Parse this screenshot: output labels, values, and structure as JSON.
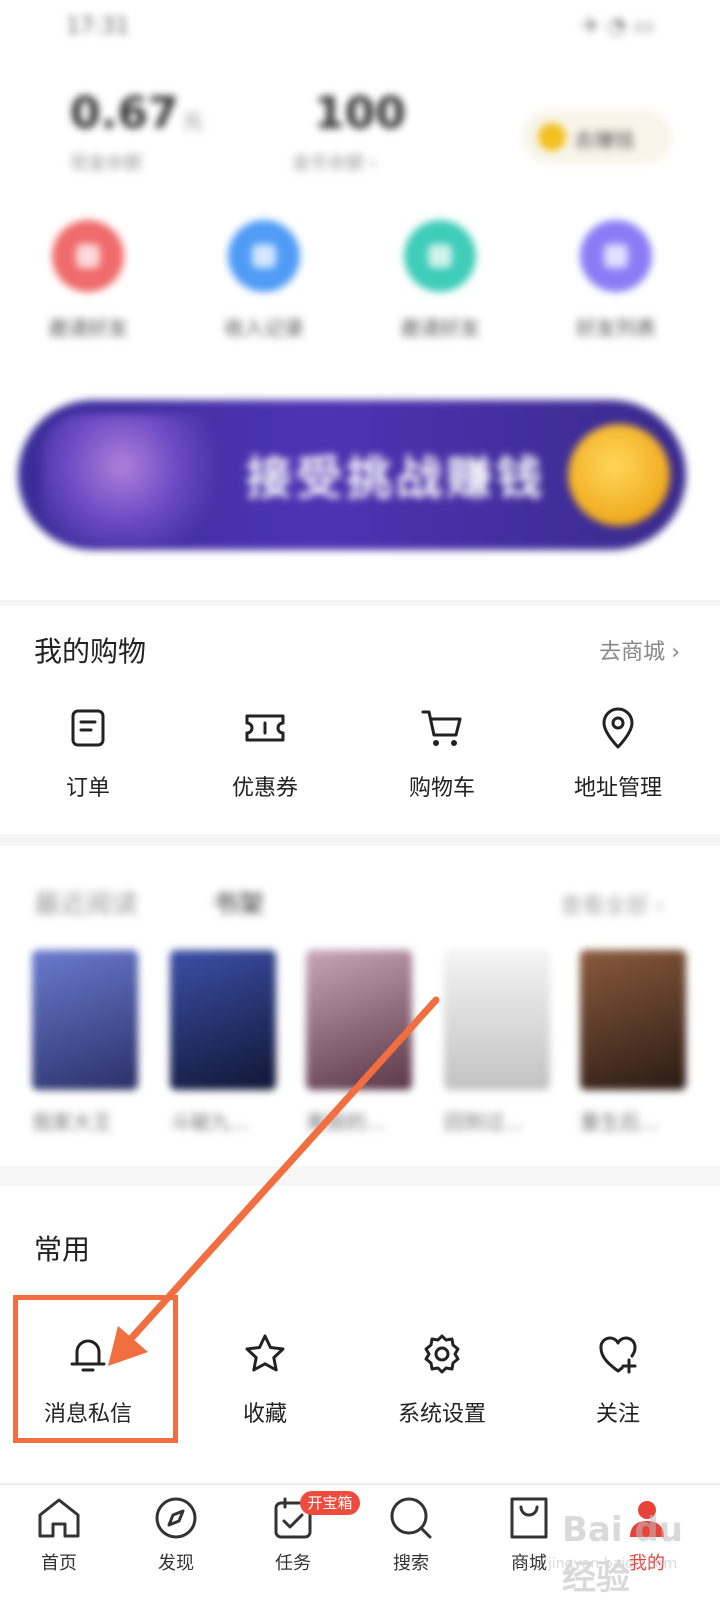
{
  "status_bar": {
    "time": "17:31",
    "system": "✈ ◔ ▭"
  },
  "stats": [
    {
      "value": "0.67",
      "unit": "元",
      "label": "现金余额"
    },
    {
      "value": "100",
      "unit": "",
      "label": "金币余额 ›"
    }
  ],
  "coin_pill": {
    "label": "去赚钱"
  },
  "quick_actions": [
    {
      "label": "邀请好友",
      "color": "#f06b6b"
    },
    {
      "label": "收入记录",
      "color": "#4f9bf5"
    },
    {
      "label": "邀请好友",
      "color": "#3ecdb8"
    },
    {
      "label": "好友列表",
      "color": "#8a7cf5"
    }
  ],
  "banner": {
    "text": "接受挑战赚钱"
  },
  "shopping": {
    "title": "我的购物",
    "link": "去商城",
    "items": [
      {
        "label": "订单",
        "icon": "order-icon"
      },
      {
        "label": "优惠券",
        "icon": "coupon-icon"
      },
      {
        "label": "购物车",
        "icon": "cart-icon"
      },
      {
        "label": "地址管理",
        "icon": "location-pin-icon"
      }
    ]
  },
  "books": {
    "tab_recent": "最近阅读",
    "tab_shelf": "书架",
    "more": "查看全部 ›",
    "items": [
      {
        "title": "我家大王",
        "color": "#3d4b8a"
      },
      {
        "title": "斗破九...",
        "color": "#1d2a5c"
      },
      {
        "title": "美丽的...",
        "color": "#8a5a6a"
      },
      {
        "title": "回到过...",
        "color": "#d8d8d8"
      },
      {
        "title": "重生后...",
        "color": "#4a2f26"
      }
    ]
  },
  "common": {
    "title": "常用",
    "items": [
      {
        "label": "消息私信",
        "icon": "bell-icon"
      },
      {
        "label": "收藏",
        "icon": "star-icon"
      },
      {
        "label": "系统设置",
        "icon": "gear-icon"
      },
      {
        "label": "关注",
        "icon": "heart-plus-icon"
      }
    ]
  },
  "tabbar": {
    "items": [
      {
        "label": "首页",
        "icon": "home-icon"
      },
      {
        "label": "发现",
        "icon": "compass-icon"
      },
      {
        "label": "任务",
        "icon": "task-icon"
      },
      {
        "label": "搜索",
        "icon": "search-icon"
      },
      {
        "label": "商城",
        "icon": "shopping-bag-icon"
      },
      {
        "label": "我的",
        "icon": "profile-icon",
        "active": true
      }
    ],
    "badge": "开宝箱"
  },
  "watermark": {
    "brand": "Bai du 经验",
    "url": "jingyan.baidu.com"
  },
  "colors": {
    "accent": "#e8433a",
    "annotation": "#f06e3f"
  }
}
